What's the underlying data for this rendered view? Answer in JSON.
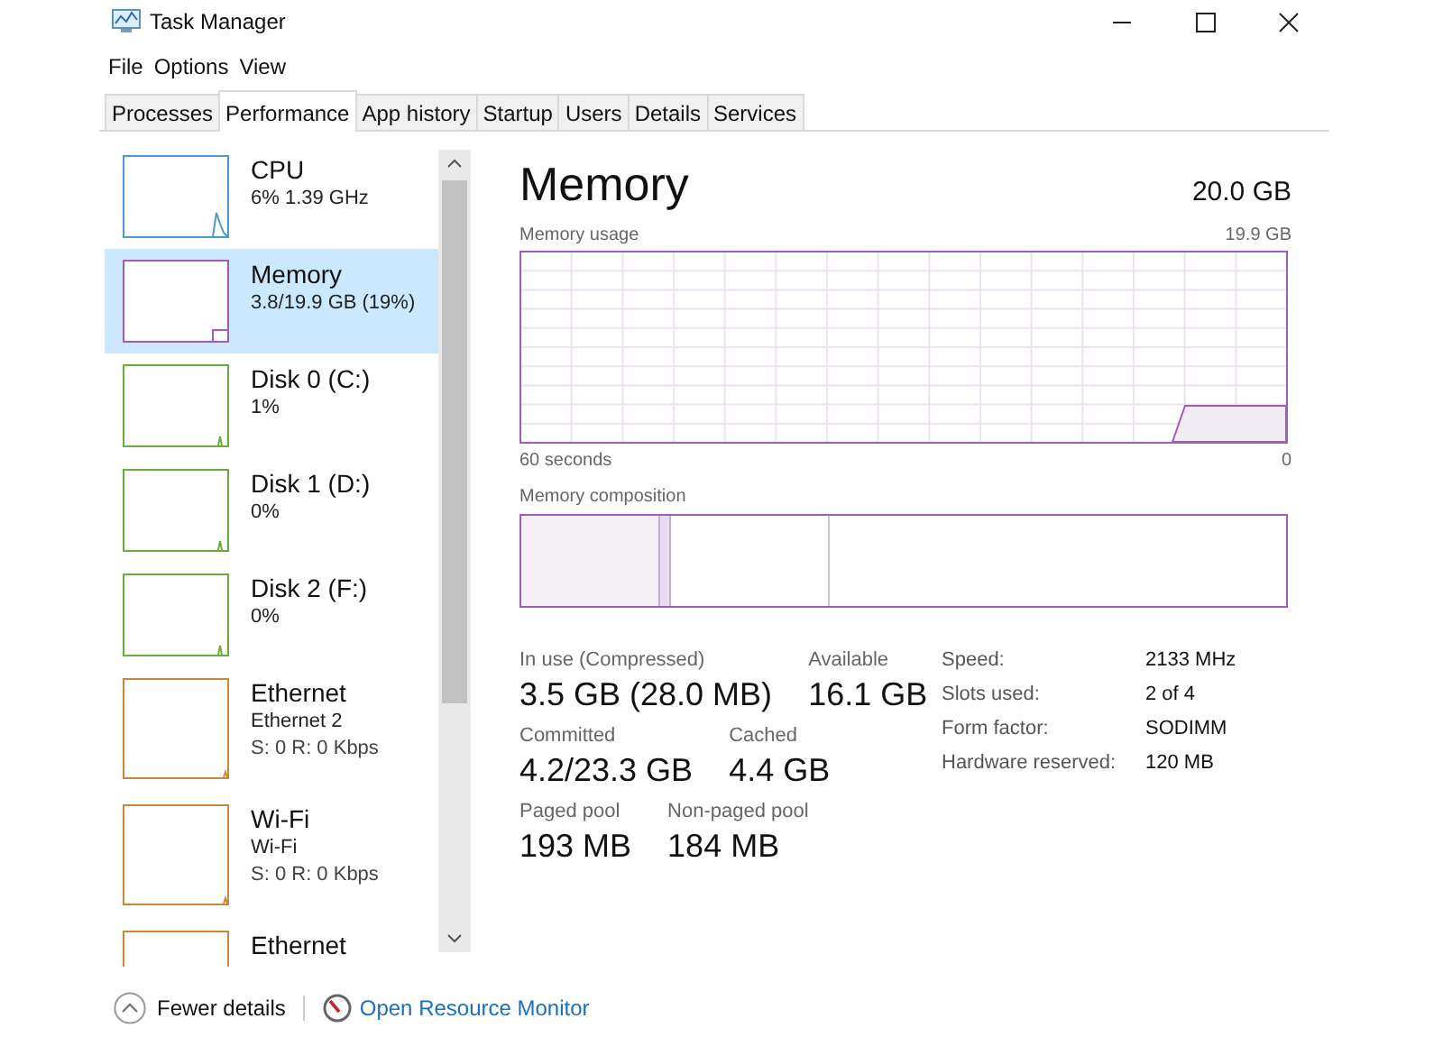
{
  "window": {
    "title": "Task Manager"
  },
  "menu": [
    "File",
    "Options",
    "View"
  ],
  "tabs": [
    {
      "label": "Processes",
      "selected": false
    },
    {
      "label": "Performance",
      "selected": true
    },
    {
      "label": "App history",
      "selected": false
    },
    {
      "label": "Startup",
      "selected": false
    },
    {
      "label": "Users",
      "selected": false
    },
    {
      "label": "Details",
      "selected": false
    },
    {
      "label": "Services",
      "selected": false
    }
  ],
  "sidebar": {
    "items": [
      {
        "kind": "cpu",
        "title": "CPU",
        "detail": "6%  1.39 GHz",
        "color": "#4a9bc9",
        "selected": false
      },
      {
        "kind": "memory",
        "title": "Memory",
        "detail": "3.8/19.9 GB (19%)",
        "color": "#a05cb8",
        "selected": true
      },
      {
        "kind": "disk",
        "title": "Disk 0 (C:)",
        "detail": "1%",
        "color": "#6aad3c",
        "selected": false
      },
      {
        "kind": "disk",
        "title": "Disk 1 (D:)",
        "detail": "0%",
        "color": "#6aad3c",
        "selected": false
      },
      {
        "kind": "disk",
        "title": "Disk 2 (F:)",
        "detail": "0%",
        "color": "#6aad3c",
        "selected": false
      },
      {
        "kind": "network",
        "title": "Ethernet",
        "detail": "Ethernet 2",
        "rate": "S: 0 R: 0 Kbps",
        "color": "#c8893a",
        "selected": false
      },
      {
        "kind": "network",
        "title": "Wi-Fi",
        "detail": "Wi-Fi",
        "rate": "S: 0 R: 0 Kbps",
        "color": "#c8893a",
        "selected": false
      },
      {
        "kind": "network",
        "title": "Ethernet",
        "color": "#c8893a",
        "selected": false
      }
    ]
  },
  "detail": {
    "title": "Memory",
    "capacity": "20.0 GB",
    "usage_graph": {
      "label": "Memory usage",
      "max": "19.9 GB",
      "time_span": "60 seconds",
      "min": "0"
    },
    "composition": {
      "label": "Memory composition"
    },
    "stats": [
      [
        {
          "label": "In use (Compressed)",
          "value": "3.5 GB (28.0 MB)"
        },
        {
          "label": "Available",
          "value": "16.1 GB"
        }
      ],
      [
        {
          "label": "Committed",
          "value": "4.2/23.3 GB"
        },
        {
          "label": "Cached",
          "value": "4.4 GB"
        }
      ],
      [
        {
          "label": "Paged pool",
          "value": "193 MB"
        },
        {
          "label": "Non-paged pool",
          "value": "184 MB"
        }
      ]
    ],
    "properties": [
      {
        "label": "Speed:",
        "value": "2133 MHz"
      },
      {
        "label": "Slots used:",
        "value": "2 of 4"
      },
      {
        "label": "Form factor:",
        "value": "SODIMM"
      },
      {
        "label": "Hardware reserved:",
        "value": "120 MB"
      }
    ]
  },
  "footer": {
    "fewer_details": "Fewer details",
    "resource_monitor_link": "Open Resource Monitor"
  }
}
